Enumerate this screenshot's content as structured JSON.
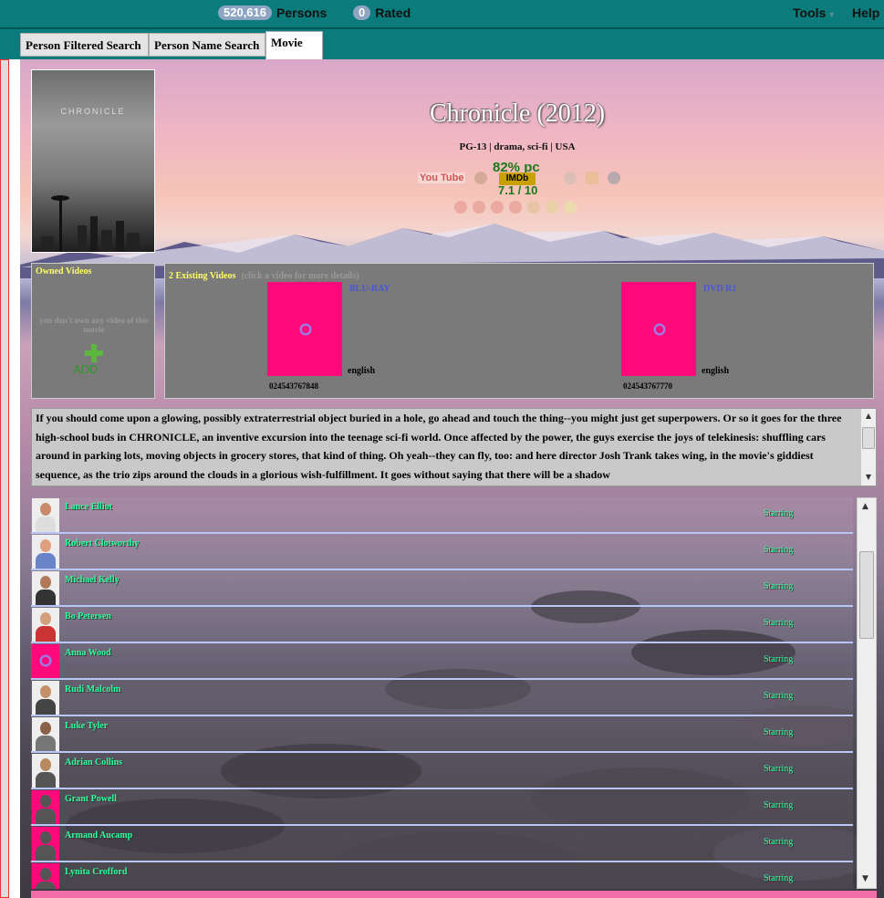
{
  "topbar": {
    "persons_count": "520,616",
    "persons_label": "Persons",
    "rated_count": "0",
    "rated_label": "Rated",
    "tools_label": "Tools",
    "help_label": "Help"
  },
  "tabs": [
    {
      "label": "Person Filtered Search"
    },
    {
      "label": "Person Name Search"
    },
    {
      "label": "Movie"
    }
  ],
  "movie": {
    "title": "Chronicle (2012)",
    "poster_title": "CHRONICLE",
    "meta": "PG-13 | drama, sci-fi | USA",
    "youtube_label": "You Tube",
    "percent": "82% pc",
    "imdb_label": "IMDb",
    "imdb_rating": "7.1 / 10"
  },
  "owned": {
    "title": "Owned Videos",
    "empty_text": "you don't own any video of this movie",
    "add_label": "ADD"
  },
  "existing": {
    "title": "2  Existing Videos",
    "hint": "(click a video for more details)",
    "videos": [
      {
        "format": "BLU-RAY",
        "language": "english",
        "upc": "024543767848"
      },
      {
        "format": "DVD R1",
        "language": "english",
        "upc": "024543767770"
      }
    ]
  },
  "synopsis": "If you should come upon a glowing, possibly extraterrestrial object buried in a hole, go ahead and touch the thing--you might just get superpowers. Or so it goes for the three high-school buds in CHRONICLE, an inventive excursion into the teenage sci-fi world. Once affected by the power, the guys exercise the joys of telekinesis: shuffling cars around in parking lots, moving objects in grocery stores, that kind of thing. Oh yeah--they can fly, too: and here director Josh Trank takes wing, in the movie's giddiest sequence, as the trio zips around the clouds in a glorious wish-fulfillment. It goes without saying that there will be a shadow",
  "cast": [
    {
      "name": "Lance Elliot",
      "role": "Starring",
      "avatar": "photo"
    },
    {
      "name": "Robert Clotworthy",
      "role": "Starring",
      "avatar": "photo"
    },
    {
      "name": "Michael Kelly",
      "role": "Starring",
      "avatar": "photo"
    },
    {
      "name": "Bo Petersen",
      "role": "Starring",
      "avatar": "photo"
    },
    {
      "name": "Anna Wood",
      "role": "Starring",
      "avatar": "loading"
    },
    {
      "name": "Rudi Malcolm",
      "role": "Starring",
      "avatar": "photo"
    },
    {
      "name": "Luke Tyler",
      "role": "Starring",
      "avatar": "photo"
    },
    {
      "name": "Adrian Collins",
      "role": "Starring",
      "avatar": "photo"
    },
    {
      "name": "Grant Powell",
      "role": "Starring",
      "avatar": "placeholder"
    },
    {
      "name": "Armand Aucamp",
      "role": "Starring",
      "avatar": "placeholder"
    },
    {
      "name": "Lynita Crofford",
      "role": "Starring",
      "avatar": "placeholder"
    }
  ],
  "colors": {
    "topbar": "#0b7b7b",
    "cover_placeholder": "#ff0a7a",
    "cast_text": "#2fff9e",
    "video_format": "#4a56d6"
  }
}
